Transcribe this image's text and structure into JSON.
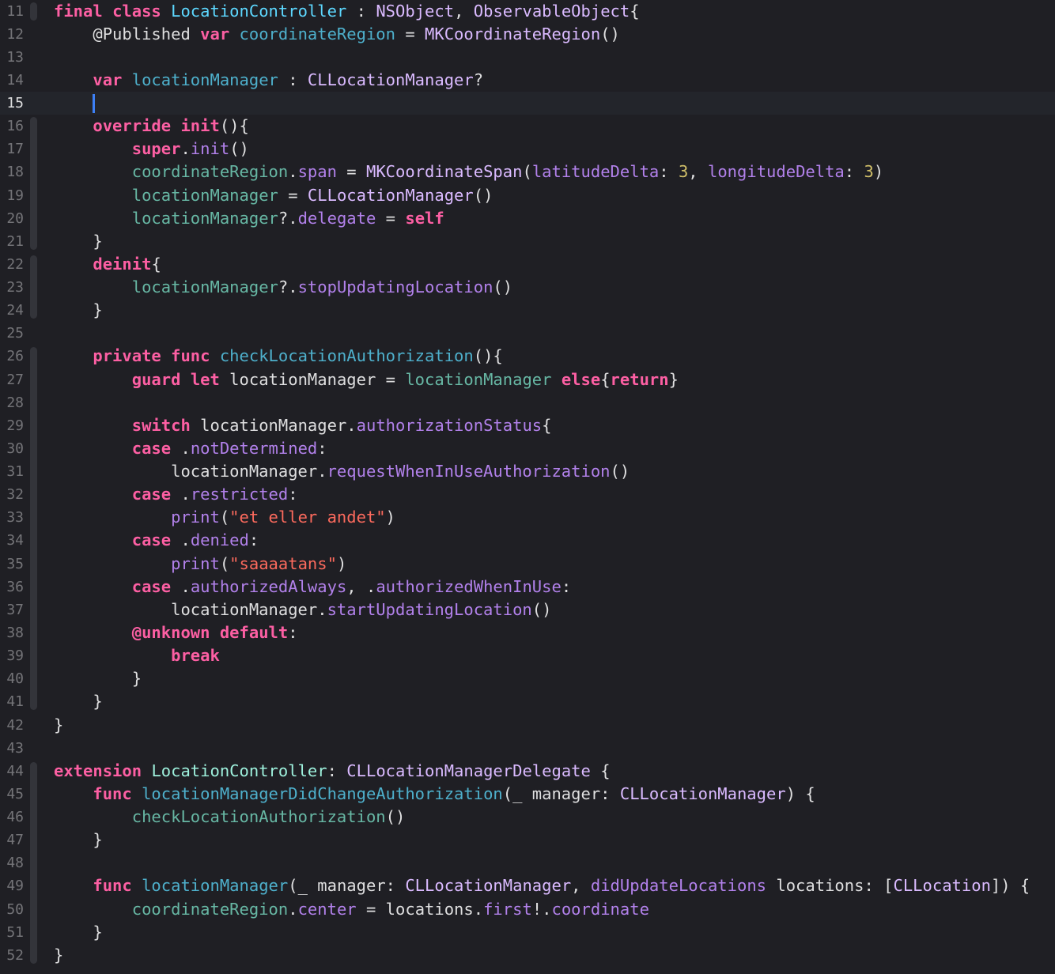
{
  "editor": {
    "current_line": 15,
    "lines": [
      {
        "n": "11",
        "tokens": [
          [
            "keyword",
            "final"
          ],
          [
            "plain",
            " "
          ],
          [
            "keyword",
            "class"
          ],
          [
            "plain",
            " "
          ],
          [
            "dtype",
            "LocationController"
          ],
          [
            "plain",
            " : "
          ],
          [
            "stype",
            "NSObject"
          ],
          [
            "plain",
            ", "
          ],
          [
            "stype",
            "ObservableObject"
          ],
          [
            "plain",
            "{"
          ]
        ]
      },
      {
        "n": "12",
        "tokens": [
          [
            "plain",
            "    "
          ],
          [
            "attrp",
            "@Published"
          ],
          [
            "plain",
            " "
          ],
          [
            "keyword",
            "var"
          ],
          [
            "plain",
            " "
          ],
          [
            "decl",
            "coordinateRegion"
          ],
          [
            "plain",
            " = "
          ],
          [
            "stype",
            "MKCoordinateRegion"
          ],
          [
            "plain",
            "()"
          ]
        ]
      },
      {
        "n": "13",
        "tokens": []
      },
      {
        "n": "14",
        "tokens": [
          [
            "plain",
            "    "
          ],
          [
            "keyword",
            "var"
          ],
          [
            "plain",
            " "
          ],
          [
            "decl",
            "locationManager"
          ],
          [
            "plain",
            " : "
          ],
          [
            "stype",
            "CLLocationManager"
          ],
          [
            "plain",
            "?"
          ]
        ]
      },
      {
        "n": "15",
        "tokens": [
          [
            "plain",
            "    "
          ],
          [
            "caret",
            ""
          ]
        ]
      },
      {
        "n": "16",
        "tokens": [
          [
            "plain",
            "    "
          ],
          [
            "keyword",
            "override"
          ],
          [
            "plain",
            " "
          ],
          [
            "keyword",
            "init"
          ],
          [
            "plain",
            "(){"
          ]
        ]
      },
      {
        "n": "17",
        "tokens": [
          [
            "plain",
            "        "
          ],
          [
            "keyword",
            "super"
          ],
          [
            "plain",
            "."
          ],
          [
            "member",
            "init"
          ],
          [
            "plain",
            "()"
          ]
        ]
      },
      {
        "n": "18",
        "tokens": [
          [
            "plain",
            "        "
          ],
          [
            "prop",
            "coordinateRegion"
          ],
          [
            "plain",
            "."
          ],
          [
            "member",
            "span"
          ],
          [
            "plain",
            " = "
          ],
          [
            "stype",
            "MKCoordinateSpan"
          ],
          [
            "plain",
            "("
          ],
          [
            "member",
            "latitudeDelta"
          ],
          [
            "plain",
            ": "
          ],
          [
            "number",
            "3"
          ],
          [
            "plain",
            ", "
          ],
          [
            "member",
            "longitudeDelta"
          ],
          [
            "plain",
            ": "
          ],
          [
            "number",
            "3"
          ],
          [
            "plain",
            ")"
          ]
        ]
      },
      {
        "n": "19",
        "tokens": [
          [
            "plain",
            "        "
          ],
          [
            "prop",
            "locationManager"
          ],
          [
            "plain",
            " = "
          ],
          [
            "stype",
            "CLLocationManager"
          ],
          [
            "plain",
            "()"
          ]
        ]
      },
      {
        "n": "20",
        "tokens": [
          [
            "plain",
            "        "
          ],
          [
            "prop",
            "locationManager"
          ],
          [
            "plain",
            "?."
          ],
          [
            "member",
            "delegate"
          ],
          [
            "plain",
            " = "
          ],
          [
            "keyword",
            "self"
          ]
        ]
      },
      {
        "n": "21",
        "tokens": [
          [
            "plain",
            "    }"
          ]
        ]
      },
      {
        "n": "22",
        "tokens": [
          [
            "plain",
            "    "
          ],
          [
            "keyword",
            "deinit"
          ],
          [
            "plain",
            "{"
          ]
        ]
      },
      {
        "n": "23",
        "tokens": [
          [
            "plain",
            "        "
          ],
          [
            "prop",
            "locationManager"
          ],
          [
            "plain",
            "?."
          ],
          [
            "member",
            "stopUpdatingLocation"
          ],
          [
            "plain",
            "()"
          ]
        ]
      },
      {
        "n": "24",
        "tokens": [
          [
            "plain",
            "    }"
          ]
        ]
      },
      {
        "n": "25",
        "tokens": []
      },
      {
        "n": "26",
        "tokens": [
          [
            "plain",
            "    "
          ],
          [
            "keyword",
            "private"
          ],
          [
            "plain",
            " "
          ],
          [
            "keyword",
            "func"
          ],
          [
            "plain",
            " "
          ],
          [
            "decl",
            "checkLocationAuthorization"
          ],
          [
            "plain",
            "(){"
          ]
        ]
      },
      {
        "n": "27",
        "tokens": [
          [
            "plain",
            "        "
          ],
          [
            "keyword",
            "guard"
          ],
          [
            "plain",
            " "
          ],
          [
            "keyword",
            "let"
          ],
          [
            "plain",
            " locationManager = "
          ],
          [
            "prop",
            "locationManager"
          ],
          [
            "plain",
            " "
          ],
          [
            "keyword",
            "else"
          ],
          [
            "plain",
            "{"
          ],
          [
            "keyword",
            "return"
          ],
          [
            "plain",
            "}"
          ]
        ]
      },
      {
        "n": "28",
        "tokens": []
      },
      {
        "n": "29",
        "tokens": [
          [
            "plain",
            "        "
          ],
          [
            "keyword",
            "switch"
          ],
          [
            "plain",
            " locationManager."
          ],
          [
            "member",
            "authorizationStatus"
          ],
          [
            "plain",
            "{"
          ]
        ]
      },
      {
        "n": "30",
        "tokens": [
          [
            "plain",
            "        "
          ],
          [
            "keyword",
            "case"
          ],
          [
            "plain",
            " ."
          ],
          [
            "member",
            "notDetermined"
          ],
          [
            "plain",
            ":"
          ]
        ]
      },
      {
        "n": "31",
        "tokens": [
          [
            "plain",
            "            locationManager."
          ],
          [
            "member",
            "requestWhenInUseAuthorization"
          ],
          [
            "plain",
            "()"
          ]
        ]
      },
      {
        "n": "32",
        "tokens": [
          [
            "plain",
            "        "
          ],
          [
            "keyword",
            "case"
          ],
          [
            "plain",
            " ."
          ],
          [
            "member",
            "restricted"
          ],
          [
            "plain",
            ":"
          ]
        ]
      },
      {
        "n": "33",
        "tokens": [
          [
            "plain",
            "            "
          ],
          [
            "member",
            "print"
          ],
          [
            "plain",
            "("
          ],
          [
            "string",
            "\"et eller andet\""
          ],
          [
            "plain",
            ")"
          ]
        ]
      },
      {
        "n": "34",
        "tokens": [
          [
            "plain",
            "        "
          ],
          [
            "keyword",
            "case"
          ],
          [
            "plain",
            " ."
          ],
          [
            "member",
            "denied"
          ],
          [
            "plain",
            ":"
          ]
        ]
      },
      {
        "n": "35",
        "tokens": [
          [
            "plain",
            "            "
          ],
          [
            "member",
            "print"
          ],
          [
            "plain",
            "("
          ],
          [
            "string",
            "\"saaaatans\""
          ],
          [
            "plain",
            ")"
          ]
        ]
      },
      {
        "n": "36",
        "tokens": [
          [
            "plain",
            "        "
          ],
          [
            "keyword",
            "case"
          ],
          [
            "plain",
            " ."
          ],
          [
            "member",
            "authorizedAlways"
          ],
          [
            "plain",
            ", ."
          ],
          [
            "member",
            "authorizedWhenInUse"
          ],
          [
            "plain",
            ":"
          ]
        ]
      },
      {
        "n": "37",
        "tokens": [
          [
            "plain",
            "            locationManager."
          ],
          [
            "member",
            "startUpdatingLocation"
          ],
          [
            "plain",
            "()"
          ]
        ]
      },
      {
        "n": "38",
        "tokens": [
          [
            "plain",
            "        "
          ],
          [
            "keyword",
            "@unknown"
          ],
          [
            "plain",
            " "
          ],
          [
            "keyword",
            "default"
          ],
          [
            "plain",
            ":"
          ]
        ]
      },
      {
        "n": "39",
        "tokens": [
          [
            "plain",
            "            "
          ],
          [
            "keyword",
            "break"
          ]
        ]
      },
      {
        "n": "40",
        "tokens": [
          [
            "plain",
            "        }"
          ]
        ]
      },
      {
        "n": "41",
        "tokens": [
          [
            "plain",
            "    }"
          ]
        ]
      },
      {
        "n": "42",
        "tokens": [
          [
            "plain",
            "}"
          ]
        ]
      },
      {
        "n": "43",
        "tokens": []
      },
      {
        "n": "44",
        "tokens": [
          [
            "keyword",
            "extension"
          ],
          [
            "plain",
            " "
          ],
          [
            "type",
            "LocationController"
          ],
          [
            "plain",
            ": "
          ],
          [
            "stype",
            "CLLocationManagerDelegate"
          ],
          [
            "plain",
            " {"
          ]
        ]
      },
      {
        "n": "45",
        "tokens": [
          [
            "plain",
            "    "
          ],
          [
            "keyword",
            "func"
          ],
          [
            "plain",
            " "
          ],
          [
            "decl",
            "locationManagerDidChangeAuthorization"
          ],
          [
            "plain",
            "(_ manager: "
          ],
          [
            "stype",
            "CLLocationManager"
          ],
          [
            "plain",
            ") {"
          ]
        ]
      },
      {
        "n": "46",
        "tokens": [
          [
            "plain",
            "        "
          ],
          [
            "func",
            "checkLocationAuthorization"
          ],
          [
            "plain",
            "()"
          ]
        ]
      },
      {
        "n": "47",
        "tokens": [
          [
            "plain",
            "    }"
          ]
        ]
      },
      {
        "n": "48",
        "tokens": []
      },
      {
        "n": "49",
        "tokens": [
          [
            "plain",
            "    "
          ],
          [
            "keyword",
            "func"
          ],
          [
            "plain",
            " "
          ],
          [
            "decl",
            "locationManager"
          ],
          [
            "plain",
            "(_ manager: "
          ],
          [
            "stype",
            "CLLocationManager"
          ],
          [
            "plain",
            ", "
          ],
          [
            "member",
            "didUpdateLocations"
          ],
          [
            "plain",
            " locations: ["
          ],
          [
            "stype",
            "CLLocation"
          ],
          [
            "plain",
            "]) {"
          ]
        ]
      },
      {
        "n": "50",
        "tokens": [
          [
            "plain",
            "        "
          ],
          [
            "prop",
            "coordinateRegion"
          ],
          [
            "plain",
            "."
          ],
          [
            "member",
            "center"
          ],
          [
            "plain",
            " = locations."
          ],
          [
            "member",
            "first"
          ],
          [
            "plain",
            "!."
          ],
          [
            "member",
            "coordinate"
          ]
        ]
      },
      {
        "n": "51",
        "tokens": [
          [
            "plain",
            "    }"
          ]
        ]
      },
      {
        "n": "52",
        "tokens": [
          [
            "plain",
            "}"
          ]
        ]
      }
    ]
  }
}
